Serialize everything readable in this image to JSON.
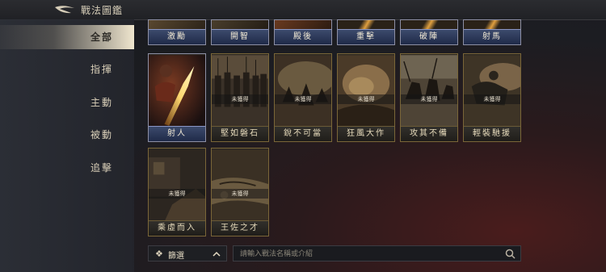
{
  "header": {
    "title": "戰法圖鑑",
    "back_icon": "back-arrow-icon"
  },
  "sidebar": {
    "items": [
      {
        "label": "全部",
        "active": true
      },
      {
        "label": "指揮",
        "active": false
      },
      {
        "label": "主動",
        "active": false
      },
      {
        "label": "被動",
        "active": false
      },
      {
        "label": "追擊",
        "active": false
      }
    ]
  },
  "top_row": [
    "激勵",
    "開智",
    "殿後",
    "重擊",
    "破陣",
    "射馬"
  ],
  "cards": [
    {
      "name": "射人",
      "locked": false,
      "status": ""
    },
    {
      "name": "堅如磐石",
      "locked": true,
      "status": "未獲得"
    },
    {
      "name": "銳不可當",
      "locked": true,
      "status": "未獲得"
    },
    {
      "name": "狂風大作",
      "locked": true,
      "status": "未獲得"
    },
    {
      "name": "攻其不備",
      "locked": true,
      "status": "未獲得"
    },
    {
      "name": "輕裝馳援",
      "locked": true,
      "status": "未獲得"
    },
    {
      "name": "乘虛而入",
      "locked": true,
      "status": "未獲得"
    },
    {
      "name": "王佐之才",
      "locked": true,
      "status": "未獲得"
    }
  ],
  "filter": {
    "label": "篩選",
    "icon": "diamond-cross-icon",
    "chevron": "chevron-up-icon"
  },
  "search": {
    "placeholder": "請輸入戰法名稱或介紹",
    "icon": "search-icon"
  },
  "colors": {
    "accent_gold": "#7a6638",
    "active_tab": "#f4e8cc",
    "blue_card": "#2c3a5c"
  }
}
